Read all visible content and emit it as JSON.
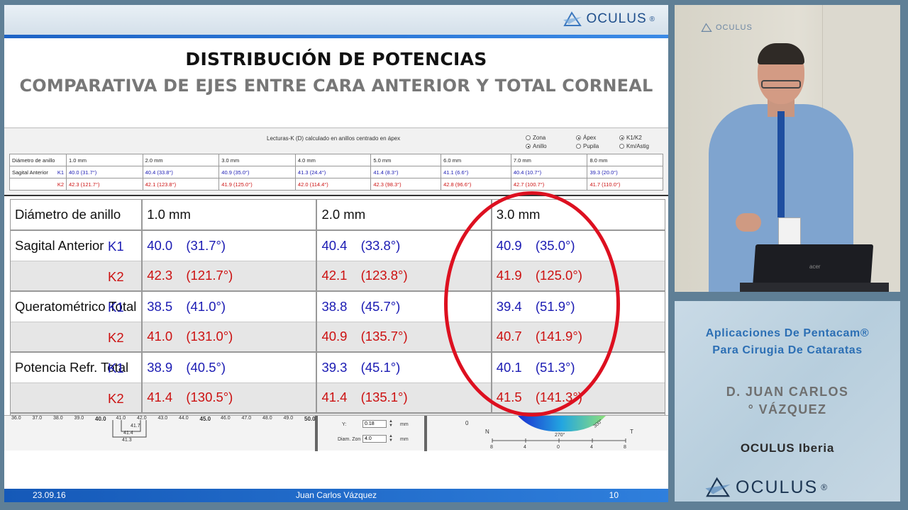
{
  "brand": {
    "name": "OCULUS",
    "reg": "®"
  },
  "slide": {
    "title": "DISTRIBUCIÓN DE POTENCIAS",
    "subtitle": "COMPARATIVA DE EJES ENTRE CARA ANTERIOR Y TOTAL CORNEAL",
    "software": {
      "caption": "Lecturas-K (D) calculado en anillos centrado en ápex",
      "options": [
        {
          "label": "Zona",
          "selected": false
        },
        {
          "label": "Ápex",
          "selected": true
        },
        {
          "label": "K1/K2",
          "selected": true
        },
        {
          "label": "Anillo",
          "selected": true
        },
        {
          "label": "Pupila",
          "selected": false
        },
        {
          "label": "Km/Astig",
          "selected": false
        }
      ],
      "small_table": {
        "label_diameter": "Diámetro de anillo",
        "label_sagittal": "Sagital Anterior",
        "k1": "K1",
        "k2": "K2",
        "diameters": [
          "1.0 mm",
          "2.0 mm",
          "3.0 mm",
          "4.0 mm",
          "5.0 mm",
          "6.0 mm",
          "7.0 mm",
          "8.0 mm"
        ],
        "k1_values": [
          "40.0  (31.7°)",
          "40.4  (33.8°)",
          "40.9  (35.0°)",
          "41.3  (24.4°)",
          "41.4  (8.3°)",
          "41.1  (6.6°)",
          "40.4  (10.7°)",
          "39.3  (20.0°)"
        ],
        "k2_values": [
          "42.3  (121.7°)",
          "42.1  (123.8°)",
          "41.9  (125.0°)",
          "42.0  (114.4°)",
          "42.3  (98.3°)",
          "42.8  (96.6°)",
          "42.7  (100.7°)",
          "41.7  (110.0°)"
        ]
      },
      "big_table": {
        "label_diameter": "Diámetro de anillo",
        "columns": [
          "1.0 mm",
          "2.0 mm",
          "3.0 mm"
        ],
        "groups": [
          {
            "label": "Sagital Anterior",
            "rows": [
              {
                "k": "K1",
                "cells": [
                  [
                    "40.0",
                    "(31.7°)"
                  ],
                  [
                    "40.4",
                    "(33.8°)"
                  ],
                  [
                    "40.9",
                    "(35.0°)"
                  ]
                ]
              },
              {
                "k": "K2",
                "cells": [
                  [
                    "42.3",
                    "(121.7°)"
                  ],
                  [
                    "42.1",
                    "(123.8°)"
                  ],
                  [
                    "41.9",
                    "(125.0°)"
                  ]
                ]
              }
            ]
          },
          {
            "label": "Queratométrico Total",
            "rows": [
              {
                "k": "K1",
                "cells": [
                  [
                    "38.5",
                    "(41.0°)"
                  ],
                  [
                    "38.8",
                    "(45.7°)"
                  ],
                  [
                    "39.4",
                    "(51.9°)"
                  ]
                ]
              },
              {
                "k": "K2",
                "cells": [
                  [
                    "41.0",
                    "(131.0°)"
                  ],
                  [
                    "40.9",
                    "(135.7°)"
                  ],
                  [
                    "40.7",
                    "(141.9°)"
                  ]
                ]
              }
            ]
          },
          {
            "label": "Potencia Refr. Total",
            "rows": [
              {
                "k": "K1",
                "cells": [
                  [
                    "38.9",
                    "(40.5°)"
                  ],
                  [
                    "39.3",
                    "(45.1°)"
                  ],
                  [
                    "40.1",
                    "(51.3°)"
                  ]
                ]
              },
              {
                "k": "K2",
                "cells": [
                  [
                    "41.4",
                    "(130.5°)"
                  ],
                  [
                    "41.4",
                    "(135.1°)"
                  ],
                  [
                    "41.5",
                    "(141.3°)"
                  ]
                ]
              }
            ]
          }
        ]
      },
      "scale": [
        "36.0",
        "37.0",
        "38.0",
        "39.0",
        "40.0",
        "41.0",
        "42.0",
        "43.0",
        "44.0",
        "45.0",
        "46.0",
        "47.0",
        "48.0",
        "49.0",
        "50.0"
      ],
      "scale_markers": [
        "41.7",
        "41.4",
        "41.3"
      ],
      "fields": {
        "y_label": "Y:",
        "y_value": "0.18",
        "unit": "mm",
        "zoom_label": "Diam. Zon",
        "zoom_value": "4.0"
      },
      "axis": {
        "n": "N",
        "t": "T",
        "zero": "0",
        "ticks": [
          "8",
          "4",
          "0",
          "4",
          "8"
        ],
        "angle1": "270°",
        "angle2": "300°"
      }
    },
    "footer": {
      "date": "23.09.16",
      "author": "Juan Carlos Vázquez",
      "page": "10"
    }
  },
  "video": {
    "laptop_brand": "acer"
  },
  "info": {
    "title_line1": "Aplicaciones De Pentacam®",
    "title_line2": "Para Cirugia De Cataratas",
    "speaker_line1": "D. JUAN CARLOS",
    "speaker_line2": "° VÁZQUEZ",
    "company": "OCULUS Iberia"
  }
}
